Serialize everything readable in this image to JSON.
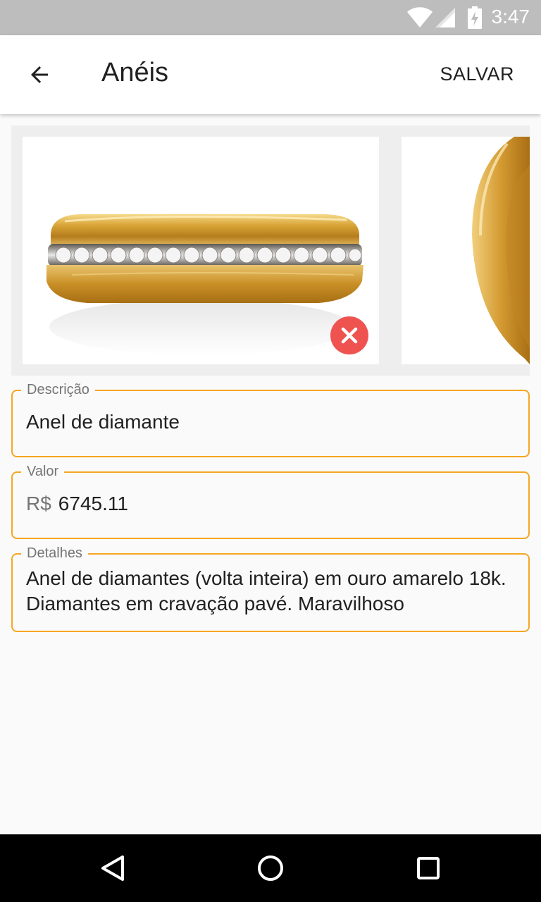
{
  "status_bar": {
    "time": "3:47",
    "icons": [
      "wifi-icon",
      "signal-icon",
      "battery-charging-icon"
    ]
  },
  "app_bar": {
    "title": "Anéis",
    "save_label": "SALVAR",
    "back_icon": "arrow-back-icon"
  },
  "gallery": {
    "images": [
      "gold-diamond-ring-photo",
      "gold-ring-photo"
    ],
    "remove_icon": "remove-photo-icon"
  },
  "form": {
    "descricao": {
      "label": "Descrição",
      "value": "Anel de diamante"
    },
    "valor": {
      "label": "Valor",
      "prefix": "R$",
      "value": "6745.11"
    },
    "detalhes": {
      "label": "Detalhes",
      "value": "Anel de diamantes (volta inteira) em ouro amarelo 18k. Diamantes em cravação pavé. Maravilhoso"
    }
  },
  "nav_bar": {
    "icons": [
      "back-triangle-icon",
      "home-circle-icon",
      "recents-square-icon"
    ]
  },
  "colors": {
    "accent": "#f5a623",
    "remove": "#ef5350",
    "status_bar": "#bdbdbd"
  }
}
